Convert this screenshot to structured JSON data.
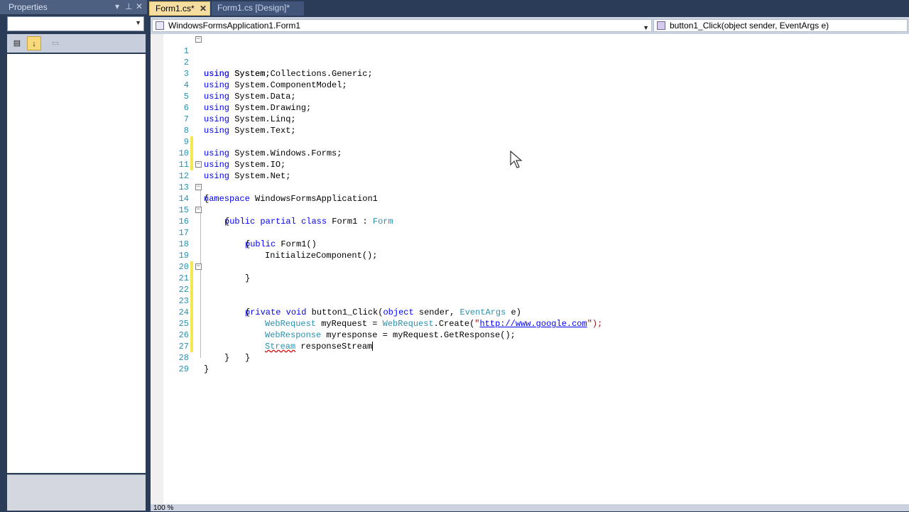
{
  "properties": {
    "title": "Properties",
    "toolbar": {
      "sort_icon": "alphabetical-sort-icon",
      "categorized_icon": "categorized-icon",
      "events_icon": "events-icon"
    }
  },
  "tabs": [
    {
      "label": "Form1.cs*",
      "active": true,
      "close": "✕"
    },
    {
      "label": "Form1.cs [Design]*",
      "active": false
    }
  ],
  "nav": {
    "left": "WindowsFormsApplication1.Form1",
    "right": "button1_Click(object sender, EventArgs e)"
  },
  "code_lines": [
    {
      "n": "1"
    },
    {
      "n": "2"
    },
    {
      "n": "3"
    },
    {
      "n": "4"
    },
    {
      "n": "5"
    },
    {
      "n": "6"
    },
    {
      "n": "7"
    },
    {
      "n": "8"
    },
    {
      "n": "9"
    },
    {
      "n": "10"
    },
    {
      "n": "11"
    },
    {
      "n": "12"
    },
    {
      "n": "13"
    },
    {
      "n": "14"
    },
    {
      "n": "15"
    },
    {
      "n": "16"
    },
    {
      "n": "17"
    },
    {
      "n": "18"
    },
    {
      "n": "19"
    },
    {
      "n": "20"
    },
    {
      "n": "21"
    },
    {
      "n": "22"
    },
    {
      "n": "23"
    },
    {
      "n": "24"
    },
    {
      "n": "25"
    },
    {
      "n": "26"
    },
    {
      "n": "27"
    },
    {
      "n": "28"
    },
    {
      "n": "29"
    }
  ],
  "code": {
    "using": "using",
    "l1": "System;",
    "l2": "System.Collections.Generic;",
    "l3": "System.ComponentModel;",
    "l4": "System.Data;",
    "l5": "System.Drawing;",
    "l6": "System.Linq;",
    "l7": "System.Text;",
    "l8": "System.Windows.Forms;",
    "l9": "System.IO;",
    "l10": "System.Net;",
    "namespace_kw": "namespace",
    "namespace_name": " WindowsFormsApplication1",
    "open": "{",
    "close": "}",
    "public": "public",
    "partial": "partial",
    "class": "class",
    "class_name": " Form1 : ",
    "form": "Form",
    "ctor": " Form1()",
    "init": "InitializeComponent();",
    "private": "private",
    "void": "void",
    "method": " button1_Click(",
    "object": "object",
    "sender": " sender, ",
    "eventargs": "EventArgs",
    "e": " e)",
    "webrequest": "WebRequest",
    "l23_mid": " myRequest = ",
    "l23_call": "WebRequest",
    "l23_create": ".Create(",
    "quote": "\"",
    "url": "http://www.google.com",
    "l23_end": "\");",
    "webresponse": "WebResponse",
    "l24_rest": " myresponse = myRequest.GetResponse();",
    "stream": "Stream",
    "l25_rest": " responseStream"
  },
  "status": {
    "zoom": "100 %"
  },
  "colors": {
    "change_marker": "#f5e84e",
    "saved_marker": "#6cc36c",
    "tab_active": "#f6dea1"
  }
}
